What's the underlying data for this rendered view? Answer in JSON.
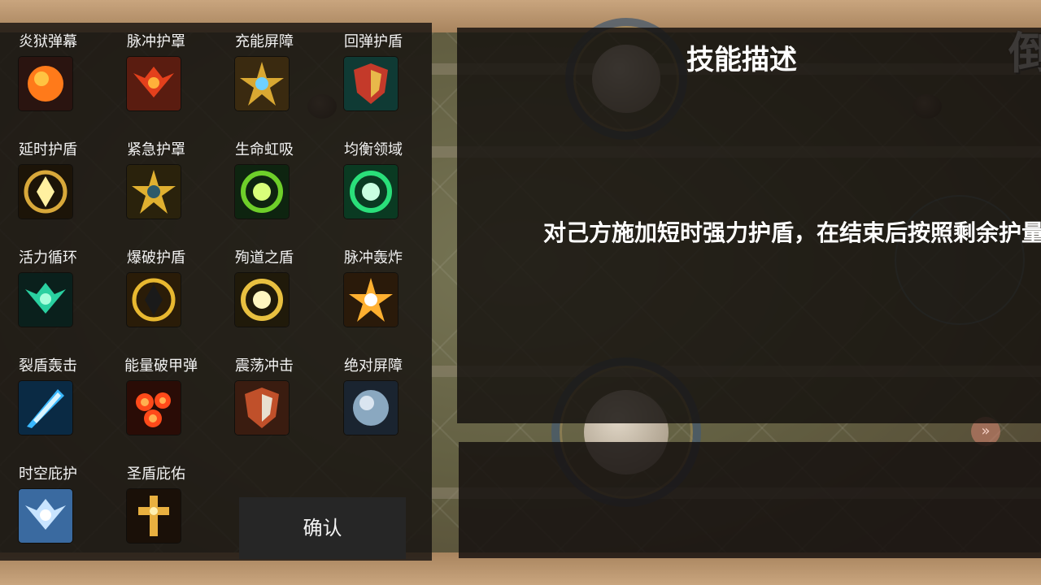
{
  "skills": [
    {
      "name": "炎狱弹幕",
      "icon": "fire-orb-icon"
    },
    {
      "name": "脉冲护罩",
      "icon": "phoenix-shield-icon"
    },
    {
      "name": "充能屏障",
      "icon": "golden-mech-icon"
    },
    {
      "name": "回弹护盾",
      "icon": "armored-warrior-icon"
    },
    {
      "name": "延时护盾",
      "icon": "golden-emblem-icon"
    },
    {
      "name": "紧急护罩",
      "icon": "gold-armor-icon"
    },
    {
      "name": "生命虹吸",
      "icon": "green-vortex-icon"
    },
    {
      "name": "均衡领域",
      "icon": "green-clock-icon"
    },
    {
      "name": "活力循环",
      "icon": "green-wings-icon"
    },
    {
      "name": "爆破护盾",
      "icon": "hooded-figure-icon"
    },
    {
      "name": "殉道之盾",
      "icon": "golden-knight-icon"
    },
    {
      "name": "脉冲轰炸",
      "icon": "lightning-blast-icon"
    },
    {
      "name": "裂盾轰击",
      "icon": "ice-sword-icon"
    },
    {
      "name": "能量破甲弹",
      "icon": "fireballs-icon"
    },
    {
      "name": "震荡冲击",
      "icon": "shield-charge-icon"
    },
    {
      "name": "绝对屏障",
      "icon": "metal-sphere-icon"
    },
    {
      "name": "时空庇护",
      "icon": "angel-wings-icon"
    },
    {
      "name": "圣盾庇佑",
      "icon": "holy-cross-icon"
    }
  ],
  "confirm_label": "确认",
  "description": {
    "title": "技能描述",
    "text": "对己方施加短时强力护盾，在结束后按照剩余护量"
  },
  "corner_char": "倒",
  "arrow_glyph": "»"
}
